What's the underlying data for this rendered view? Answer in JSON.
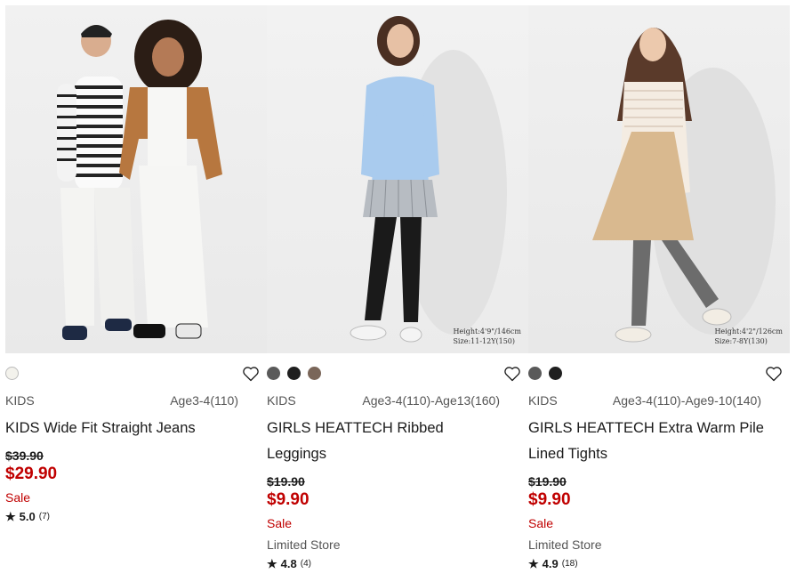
{
  "products": [
    {
      "category": "KIDS",
      "size_range": "Age3-4(110)",
      "title": "KIDS Wide Fit Straight Jeans",
      "original_price": "$39.90",
      "price": "$29.90",
      "sale_label": "Sale",
      "store_label": "",
      "rating": "5.0",
      "review_count": "(7)",
      "swatches": [
        "#f3f2ec"
      ],
      "image_caption_1": "",
      "image_caption_2": ""
    },
    {
      "category": "KIDS",
      "size_range": "Age3-4(110)-Age13(160)",
      "title": "GIRLS HEATTECH Ribbed Leggings",
      "original_price": "$19.90",
      "price": "$9.90",
      "sale_label": "Sale",
      "store_label": "Limited Store",
      "rating": "4.8",
      "review_count": "(4)",
      "swatches": [
        "#5a5a5a",
        "#1f1f1f",
        "#7a6659"
      ],
      "image_caption_1": "Height:4'9\"/146cm",
      "image_caption_2": "Size:11-12Y(150)"
    },
    {
      "category": "KIDS",
      "size_range": "Age3-4(110)-Age9-10(140)",
      "title": "GIRLS HEATTECH Extra Warm Pile Lined Tights",
      "original_price": "$19.90",
      "price": "$9.90",
      "sale_label": "Sale",
      "store_label": "Limited Store",
      "rating": "4.9",
      "review_count": "(18)",
      "swatches": [
        "#5a5a5a",
        "#1f1f1f"
      ],
      "image_caption_1": "Height:4'2\"/126cm",
      "image_caption_2": "Size:7-8Y(130)"
    }
  ],
  "icons": {
    "wishlist": "heart-outline-icon",
    "rating": "star-icon"
  },
  "colors": {
    "sale_red": "#c00000",
    "text": "#1b1b1b",
    "muted": "#555555"
  }
}
